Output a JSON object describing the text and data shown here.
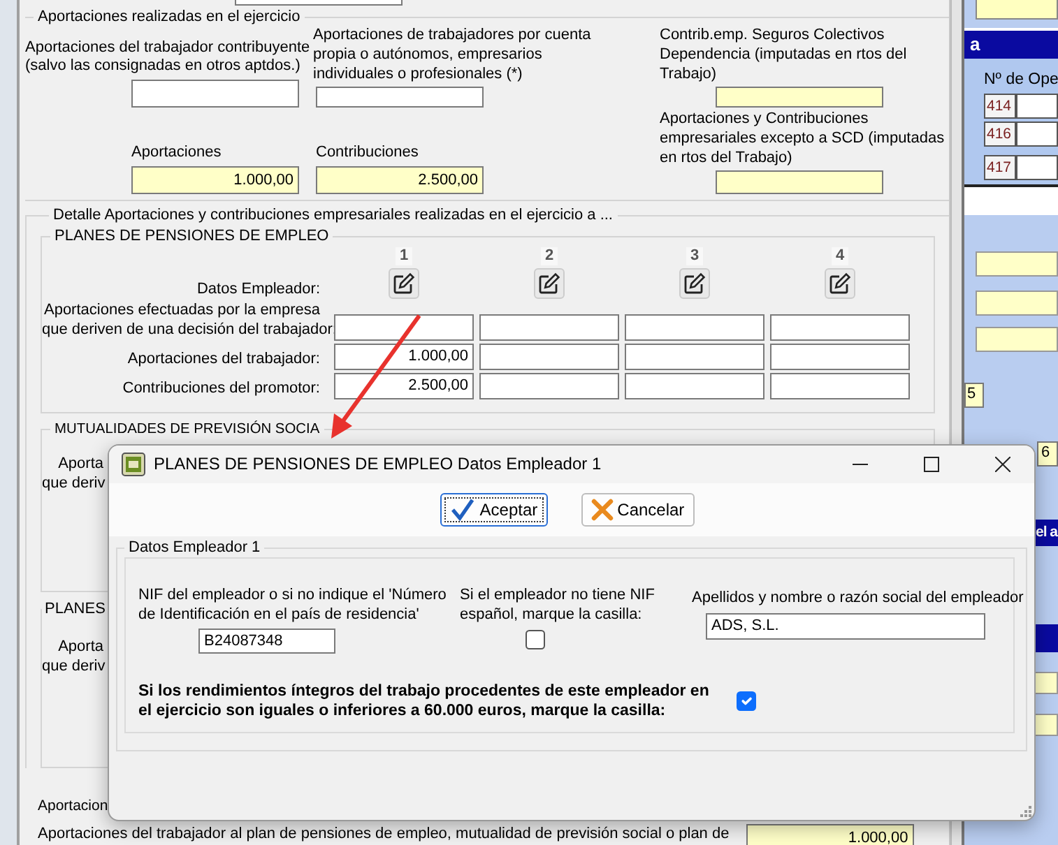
{
  "contributions": {
    "legend": "Aportaciones realizadas en el ejercicio",
    "fields": [
      {
        "label": "Aportaciones del trabajador contribuyente\n(salvo las consignadas en otros aptdos.)",
        "readonly": false
      },
      {
        "label": "Aportaciones de trabajadores por cuenta\npropia o autónomos, empresarios\nindividuales o profesionales (*)",
        "readonly": false
      },
      {
        "label": "Contrib.emp. Seguros Colectivos\nDependencia (imputadas en rtos del\nTrabajo)",
        "readonly": true
      },
      {
        "label": "Aportaciones",
        "value": "1.000,00",
        "readonly": true
      },
      {
        "label": "Contribuciones",
        "value": "2.500,00",
        "readonly": true
      },
      {
        "label": "Aportaciones y Contribuciones\nempresariales excepto a SCD (imputadas\nen rtos del Trabajo)",
        "readonly": true
      }
    ]
  },
  "detail": {
    "legend": "Detalle Aportaciones y contribuciones empresariales realizadas en el ejercicio  a ...",
    "pension_plans": {
      "legend": "PLANES DE PENSIONES DE EMPLEO",
      "columns": [
        "1",
        "2",
        "3",
        "4"
      ],
      "employer_label": "Datos Empleador:",
      "rows": [
        {
          "label": "Aportaciones efectuadas por la empresa\nque deriven de una decisión del trabajador:"
        },
        {
          "label": "Aportaciones del trabajador:",
          "values": [
            "1.000,00"
          ]
        },
        {
          "label": "Contribuciones del promotor:",
          "values": [
            "2.500,00"
          ]
        }
      ]
    },
    "mutual": {
      "legend": "MUTUALIDADES DE PREVISIÓN SOCIA",
      "row_label": "Aporta\nque deriv"
    },
    "other_plans": {
      "legend": "PLANES",
      "row_label": "Aporta\nque deriv"
    }
  },
  "bottom": {
    "heading": "Aportacion",
    "text": "Aportaciones del trabajador al plan de pensiones de empleo, mutualidad de previsión social o plan de",
    "value": "1.000,00"
  },
  "side_panel": {
    "header": "a",
    "column_heading": "Nº de Ope",
    "codes": [
      "414",
      "416",
      "417"
    ],
    "fragments": [
      {
        "text": "5",
        "kind": "box"
      },
      {
        "text": "6",
        "kind": "cell"
      },
      {
        "text": "el a",
        "kind": "band"
      }
    ]
  },
  "dialog": {
    "title": "PLANES DE PENSIONES DE EMPLEO Datos Empleador 1",
    "buttons": [
      {
        "label": "Aceptar",
        "kind": "accept",
        "focused": true
      },
      {
        "label": "Cancelar",
        "kind": "cancel",
        "focused": false
      }
    ],
    "legend": "Datos Empleador 1",
    "nif": {
      "label": "NIF del empleador o si no indique el 'Número\nde Identificación en el país de residencia'",
      "value": "B24087348"
    },
    "no_spanish_nif": {
      "label": "Si el empleador no tiene NIF\nespañol, marque la casilla:",
      "checked": false
    },
    "employer_name": {
      "label": "Apellidos y nombre o razón social del empleador",
      "value": "ADS, S.L."
    },
    "income_limit": {
      "label": "Si los rendimientos íntegros del trabajo procedentes de este empleador en\nel ejercicio son iguales o inferiores a 60.000 euros, marque la casilla:",
      "checked": true
    }
  }
}
